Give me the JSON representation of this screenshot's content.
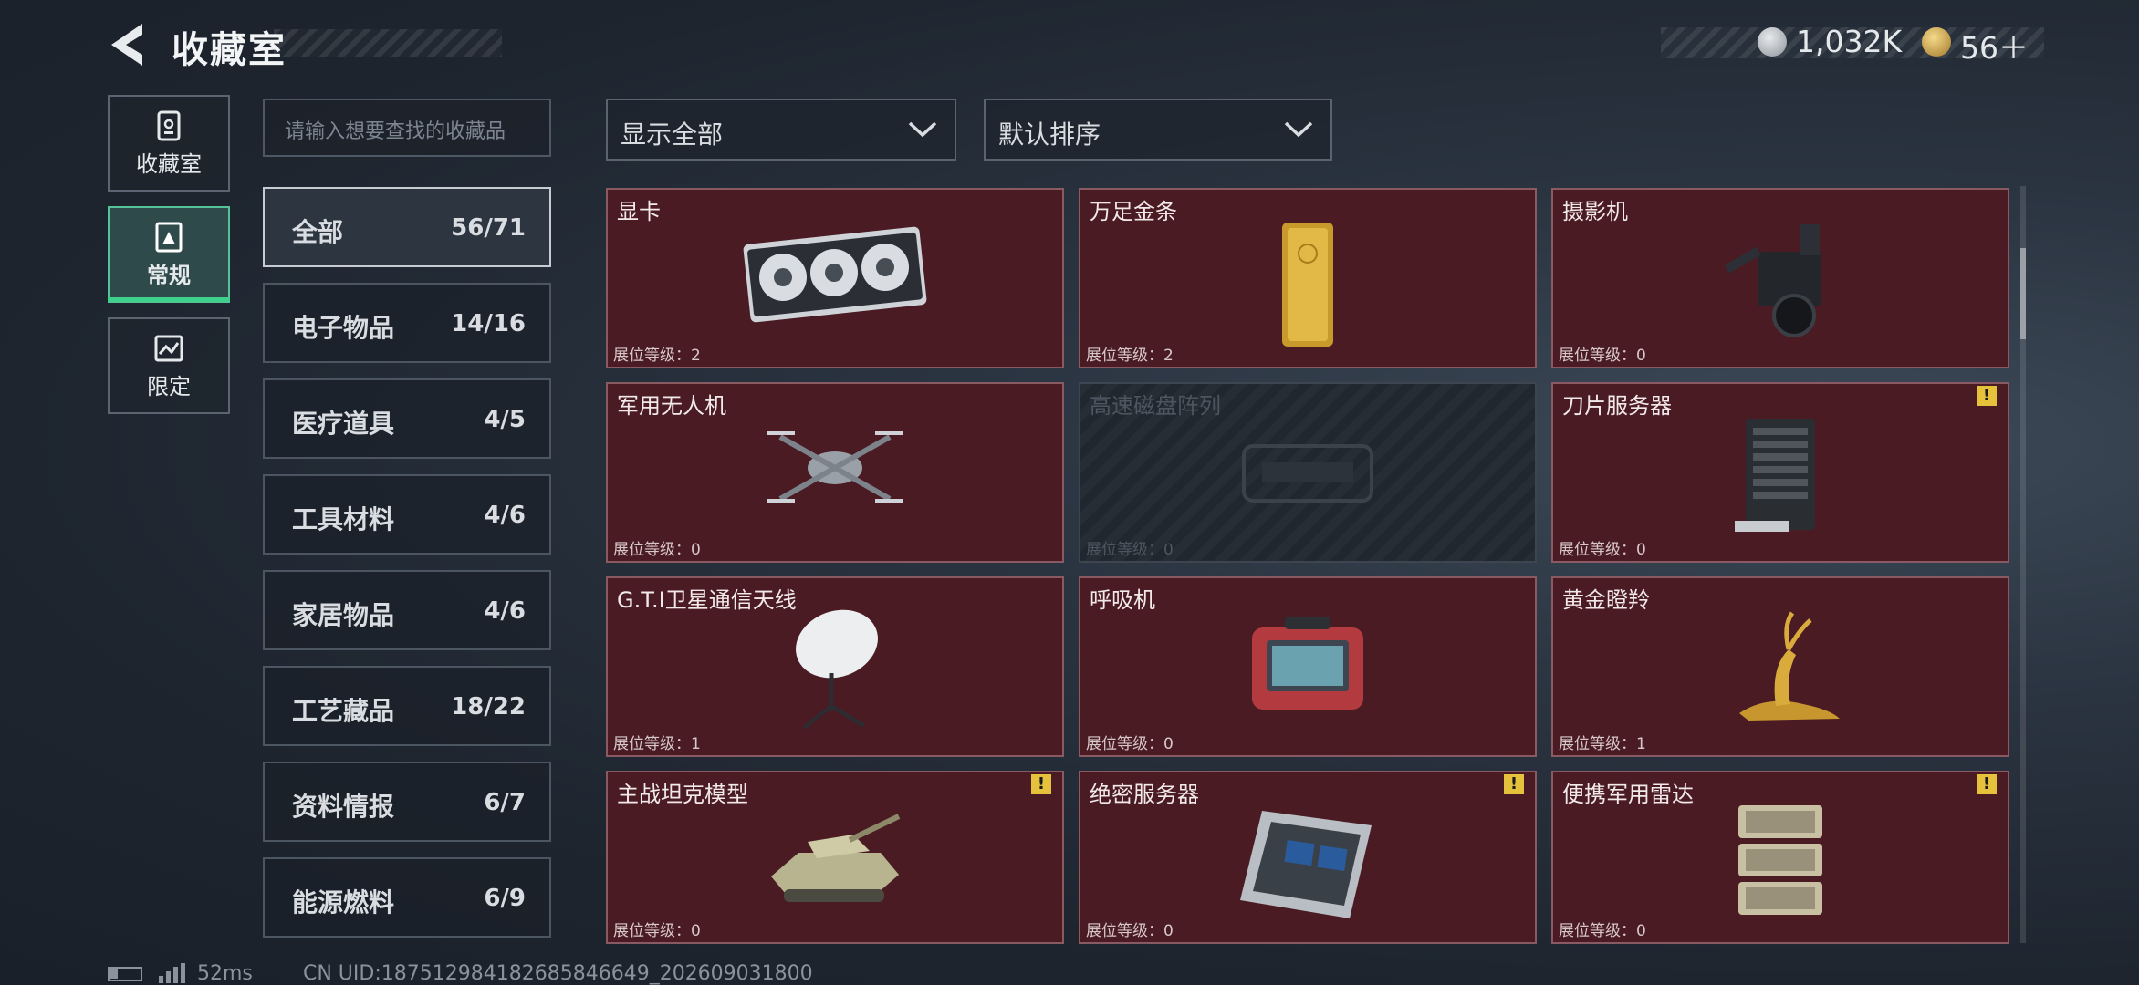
{
  "header": {
    "title": "收藏室"
  },
  "currency": [
    {
      "icon": "silver-coin-icon",
      "value": "1,032K"
    },
    {
      "icon": "gold-coin-icon",
      "value": "56＋"
    }
  ],
  "left_nav": [
    {
      "label": "收藏室",
      "icon": "collection-room-icon",
      "active": false
    },
    {
      "label": "常规",
      "icon": "regular-icon",
      "active": true
    },
    {
      "label": "限定",
      "icon": "limited-icon",
      "active": false
    }
  ],
  "search": {
    "placeholder": "请输入想要查找的收藏品"
  },
  "categories": [
    {
      "name": "全部",
      "count": "56/71",
      "active": true
    },
    {
      "name": "电子物品",
      "count": "14/16"
    },
    {
      "name": "医疗道具",
      "count": "4/5"
    },
    {
      "name": "工具材料",
      "count": "4/6"
    },
    {
      "name": "家居物品",
      "count": "4/6"
    },
    {
      "name": "工艺藏品",
      "count": "18/22"
    },
    {
      "name": "资料情报",
      "count": "6/7"
    },
    {
      "name": "能源燃料",
      "count": "6/9"
    }
  ],
  "filters": {
    "show": "显示全部",
    "sort": "默认排序"
  },
  "items": [
    {
      "name": "显卡",
      "level": "展位等级：2",
      "icon": "graphics-card-icon"
    },
    {
      "name": "万足金条",
      "level": "展位等级：2",
      "icon": "gold-bar-icon"
    },
    {
      "name": "摄影机",
      "level": "展位等级：0",
      "icon": "camera-icon"
    },
    {
      "name": "军用无人机",
      "level": "展位等级：0",
      "icon": "drone-icon"
    },
    {
      "name": "高速磁盘阵列",
      "level": "展位等级：0",
      "icon": "disk-array-icon",
      "locked": true
    },
    {
      "name": "刀片服务器",
      "level": "展位等级：0",
      "icon": "blade-server-icon",
      "warning": true
    },
    {
      "name": "G.T.I卫星通信天线",
      "level": "展位等级：1",
      "icon": "satellite-dish-icon"
    },
    {
      "name": "呼吸机",
      "level": "展位等级：0",
      "icon": "ventilator-icon"
    },
    {
      "name": "黄金瞪羚",
      "level": "展位等级：1",
      "icon": "golden-gazelle-icon"
    },
    {
      "name": "主战坦克模型",
      "level": "展位等级：0",
      "icon": "tank-model-icon",
      "warning": true
    },
    {
      "name": "绝密服务器",
      "level": "展位等级：0",
      "icon": "secret-server-icon",
      "warning": true
    },
    {
      "name": "便携军用雷达",
      "level": "展位等级：0",
      "icon": "portable-radar-icon",
      "warning": true
    }
  ],
  "footer": {
    "ping": "52ms",
    "uid": "CN UID:18751298418268584​6649_202609031800"
  },
  "colors": {
    "card_bg": "#4a1b23",
    "accent_green": "#3fd08c",
    "warning_yellow": "#e6c13c"
  }
}
